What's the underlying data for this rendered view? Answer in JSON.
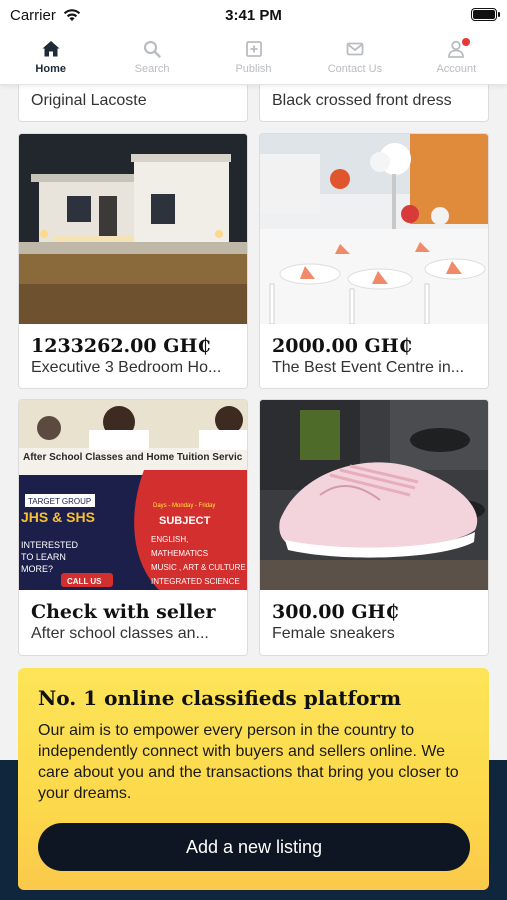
{
  "status_bar": {
    "carrier": "Carrier",
    "time": "3:41 PM"
  },
  "nav": {
    "items": [
      {
        "label": "Home",
        "icon": "home-icon",
        "active": true
      },
      {
        "label": "Search",
        "icon": "search-icon",
        "active": false
      },
      {
        "label": "Publish",
        "icon": "plus-square-icon",
        "active": false
      },
      {
        "label": "Contact Us",
        "icon": "mail-icon",
        "active": false
      },
      {
        "label": "Account",
        "icon": "user-icon",
        "active": false
      }
    ]
  },
  "listings": {
    "top_row": [
      {
        "title": "Original Lacoste"
      },
      {
        "title": "Black crossed front dress"
      }
    ],
    "grid": [
      {
        "price": "1233262.00 GH₵",
        "title": "Executive 3 Bedroom Ho..."
      },
      {
        "price": "2000.00 GH₵",
        "title": "The Best Event Centre in..."
      },
      {
        "price": "Check with seller",
        "title": "After school classes an..."
      },
      {
        "price": "300.00 GH₵",
        "title": "Female sneakers"
      }
    ]
  },
  "school_ad": {
    "banner": "After School Classes and Home Tuition Servic",
    "target_group": "TARGET GROUP",
    "levels": "JHS & SHS",
    "days": "Days - Monday - Friday",
    "subject_heading": "SUBJECT",
    "subjects": [
      "ENGLISH,",
      "MATHEMATICS",
      "MUSIC , ART & CULTURE",
      "INTEGRATED SCIENCE"
    ],
    "interest_lines": [
      "INTERESTED",
      "TO LEARN",
      "MORE?"
    ],
    "call": "CALL US"
  },
  "promo": {
    "heading": "No. 1 online classifieds platform",
    "body": "Our aim is to empower every person in the country to independently connect with buyers and sellers online. We care about you and the transactions that bring you closer to your dreams.",
    "cta": "Add a new listing"
  },
  "colors": {
    "nav_active": "#1e2a38",
    "nav_inactive": "#b9bcc2",
    "promo_yellow": "#fde458",
    "cta_dark": "#0d1622",
    "footer_navy": "#10263c",
    "notification_red": "#e53935"
  }
}
